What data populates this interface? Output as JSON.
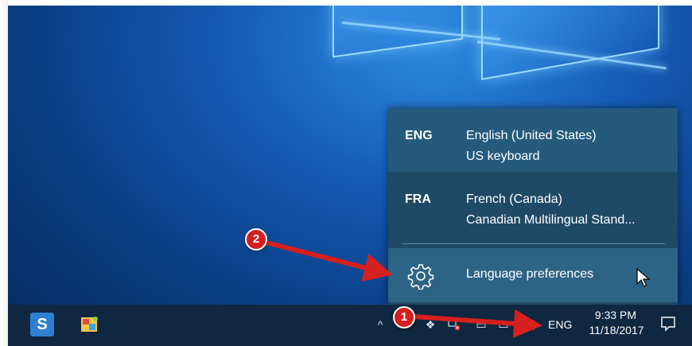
{
  "language_flyout": {
    "languages": [
      {
        "code": "ENG",
        "name": "English (United States)",
        "keyboard": "US keyboard"
      },
      {
        "code": "FRA",
        "name": "French (Canada)",
        "keyboard": "Canadian Multilingual Stand..."
      }
    ],
    "preferences_label": "Language preferences"
  },
  "taskbar": {
    "language_indicator": "ENG",
    "time": "9:33 PM",
    "date": "11/18/2017",
    "pinned_icons": [
      "snagit-icon",
      "paint-app-icon"
    ],
    "tray_icons": [
      "chevron-up-icon",
      "wifi-icon",
      "dropbox-icon",
      "network-error-icon",
      "battery-icon",
      "display-icon",
      "volume-icon"
    ]
  },
  "annotations": {
    "step_1": "1",
    "step_2": "2",
    "color": "#d61f1f"
  },
  "colors": {
    "flyout_bg": "#1f4a66",
    "flyout_selected": "#255a7c",
    "flyout_hover": "#2d6485",
    "taskbar_bg": "#0f2740"
  }
}
